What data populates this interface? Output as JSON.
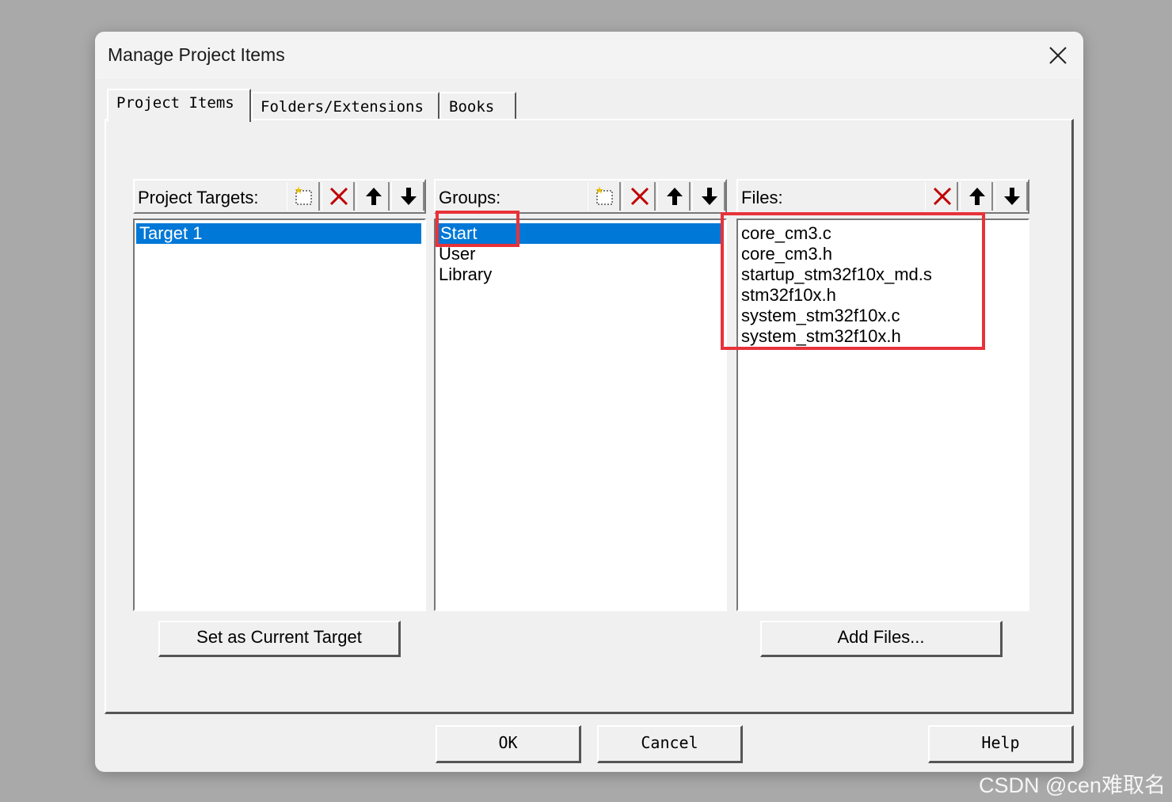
{
  "dialog": {
    "title": "Manage Project Items",
    "close_icon": "close-icon",
    "tabs": [
      {
        "label": "Project Items",
        "active": true
      },
      {
        "label": "Folders/Extensions",
        "active": false
      },
      {
        "label": "Books",
        "active": false
      }
    ],
    "targets": {
      "label": "Project Targets:",
      "toolbar_icons": [
        "new-icon",
        "delete-icon",
        "move-up-icon",
        "move-down-icon"
      ],
      "items": [
        {
          "label": "Target 1",
          "selected": true
        }
      ],
      "button_label": "Set as Current Target"
    },
    "groups": {
      "label": "Groups:",
      "toolbar_icons": [
        "new-icon",
        "delete-icon",
        "move-up-icon",
        "move-down-icon"
      ],
      "items": [
        {
          "label": "Start",
          "selected": true
        },
        {
          "label": "User",
          "selected": false
        },
        {
          "label": "Library",
          "selected": false
        }
      ]
    },
    "files": {
      "label": "Files:",
      "toolbar_icons": [
        "delete-icon",
        "move-up-icon",
        "move-down-icon"
      ],
      "items": [
        {
          "label": "core_cm3.c"
        },
        {
          "label": "core_cm3.h"
        },
        {
          "label": "startup_stm32f10x_md.s"
        },
        {
          "label": "stm32f10x.h"
        },
        {
          "label": "system_stm32f10x.c"
        },
        {
          "label": "system_stm32f10x.h"
        }
      ],
      "button_label": "Add Files..."
    },
    "footer": {
      "ok_label": "OK",
      "cancel_label": "Cancel",
      "help_label": "Help"
    }
  },
  "watermark": "CSDN @cen难取名",
  "colors": {
    "selection": "#0078d7",
    "annotation_red": "#e8323a",
    "backdrop": "#a9a9a9"
  }
}
